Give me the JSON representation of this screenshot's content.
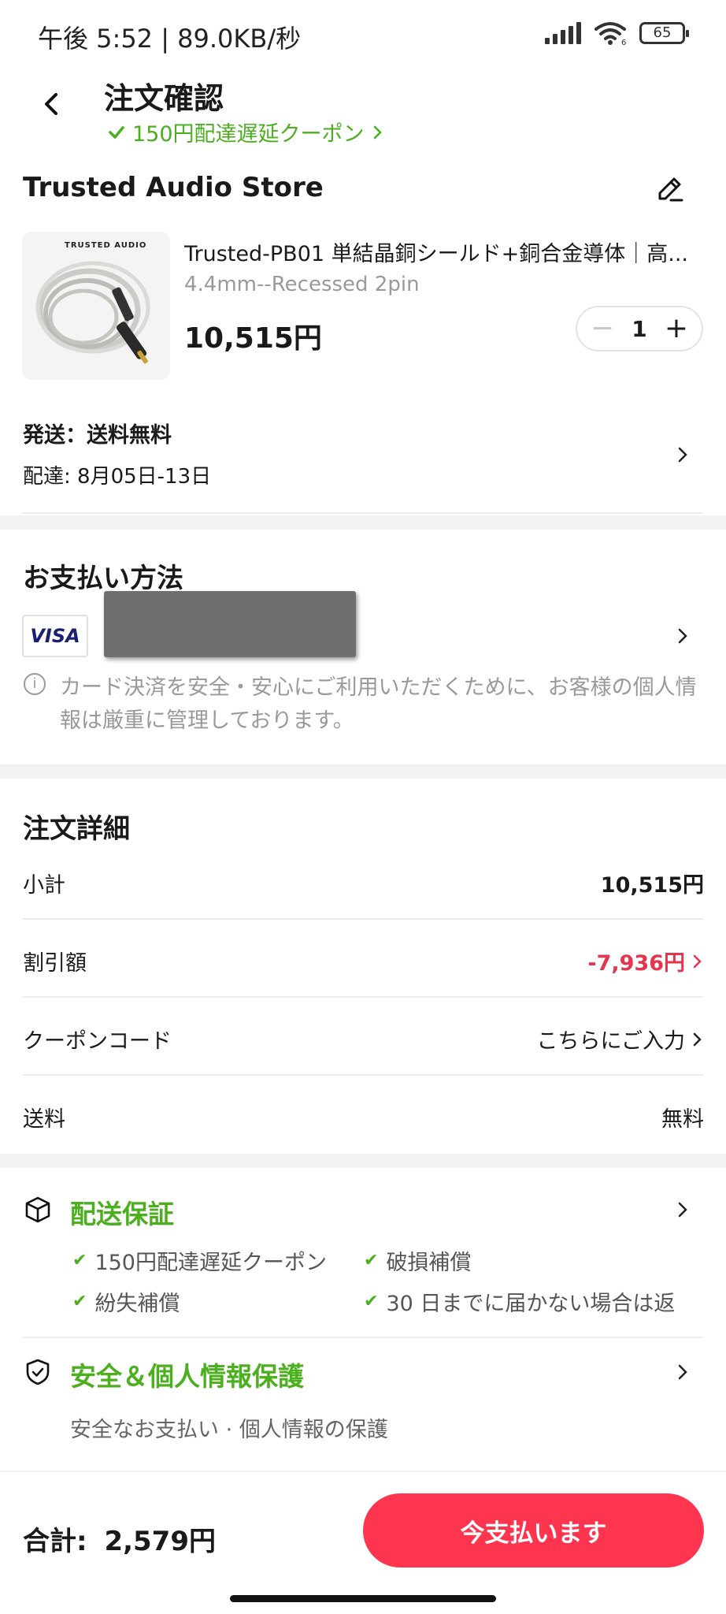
{
  "status_bar": {
    "time_speed": "午後 5:52 | 89.0KB/秒",
    "battery": "65",
    "network_label": "6"
  },
  "header": {
    "title": "注文確認",
    "coupon": "150円配達遅延クーポン"
  },
  "store": {
    "name": "Trusted Audio Store"
  },
  "product": {
    "image_brand": "TRUSTED AUDIO",
    "title": "Trusted-PB01 単結晶銅シールド+銅合金導体｜高...",
    "variant": "4.4mm--Recessed 2pin",
    "price": "10,515円",
    "quantity": "1"
  },
  "shipping": {
    "label": "発送：送料無料",
    "delivery": "配達: 8月05日-13日"
  },
  "payment": {
    "title": "お支払い方法",
    "card_brand": "VISA",
    "info_text": "カード決済を安全・安心にご利用いただくために、お客様の個人情報は厳重に管理しております。"
  },
  "order_details": {
    "title": "注文詳細",
    "rows": [
      {
        "label": "小計",
        "value": "10,515円"
      },
      {
        "label": "割引額",
        "value": "-7,936円"
      },
      {
        "label": "クーポンコード",
        "value": "こちらにご入力"
      },
      {
        "label": "送料",
        "value": "無料"
      }
    ]
  },
  "delivery_guarantee": {
    "title": "配送保証",
    "items": [
      "150円配達遅延クーポン",
      "破損補償",
      "紛失補償",
      "30 日までに届かない場合は返"
    ]
  },
  "security": {
    "title": "安全＆個人情報保護",
    "subtitle": "安全なお支払い · 個人情報の保護"
  },
  "footer": {
    "total_label": "合計:",
    "total_value": "2,579円",
    "pay_button": "今支払います"
  },
  "colors": {
    "accent_green": "#4caf1e",
    "discount_red": "#e5344d",
    "pay_button": "#ff344f"
  },
  "icons": [
    "back-arrow-icon",
    "edit-pencil-icon",
    "chevron-right-icon",
    "info-icon",
    "check-icon",
    "package-box-icon",
    "shield-check-icon"
  ]
}
